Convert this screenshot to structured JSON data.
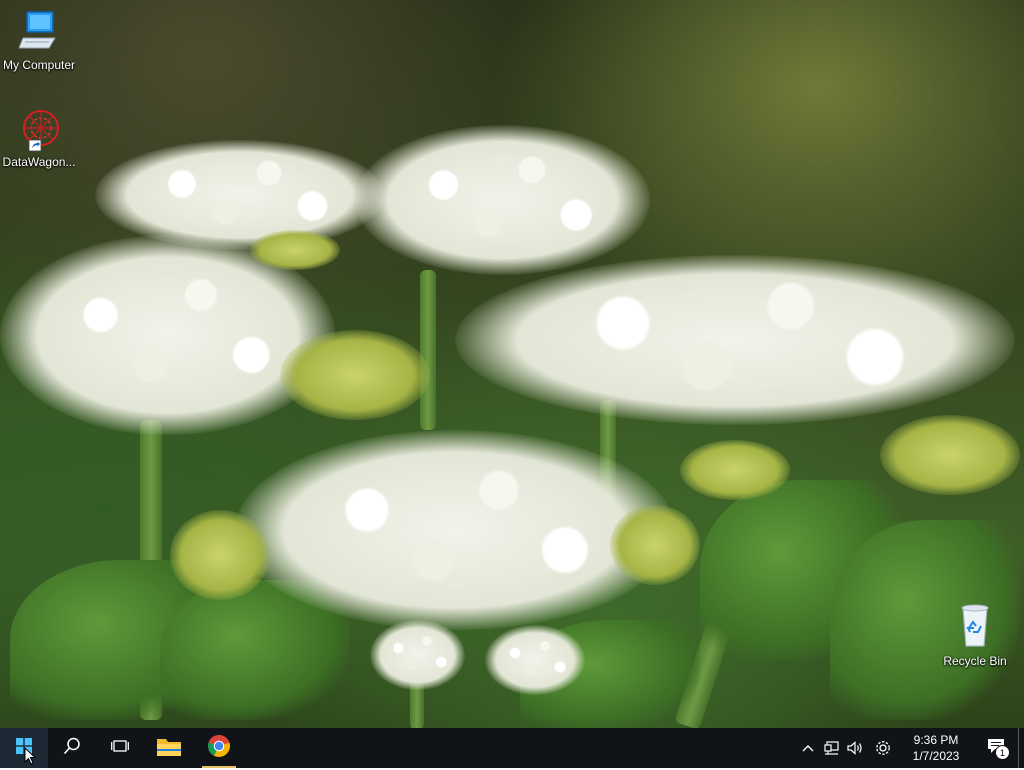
{
  "desktop": {
    "icons": [
      {
        "label": "My Computer",
        "icon": "computer-icon"
      },
      {
        "label": "DataWagon...",
        "icon": "datawagon-shortcut-icon"
      },
      {
        "label": "Recycle Bin",
        "icon": "recycle-bin-icon"
      }
    ]
  },
  "taskbar": {
    "start": {
      "icon": "windows-logo-icon"
    },
    "search": {
      "icon": "search-icon"
    },
    "task_view": {
      "icon": "task-view-icon"
    },
    "pinned": [
      {
        "name": "File Explorer",
        "icon": "folder-icon"
      },
      {
        "name": "Google Chrome",
        "icon": "chrome-icon",
        "active": true
      }
    ],
    "tray": {
      "icons": [
        "chevron-up-icon",
        "network-icon",
        "volume-icon",
        "settings-icon"
      ],
      "time": "9:36 PM",
      "date": "1/7/2023",
      "notification_count": "1"
    }
  },
  "colors": {
    "taskbar_bg": "#101418",
    "active_indicator": "#e8c26a",
    "start_logo": "#4cc2ff"
  }
}
